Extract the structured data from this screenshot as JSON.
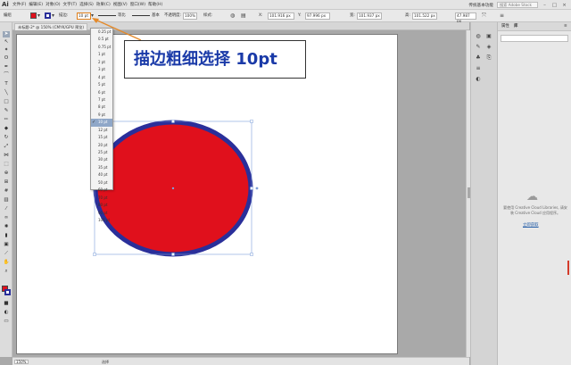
{
  "app": {
    "logo": "Ai",
    "menu": [
      "文件(F)",
      "编辑(E)",
      "对象(O)",
      "文字(T)",
      "选择(S)",
      "效果(C)",
      "视图(V)",
      "窗口(W)",
      "帮助(H)"
    ],
    "workspace": "传统基本功能",
    "search_placeholder": "搜索 Adobe Stock",
    "window_buttons": [
      "–",
      "□",
      "×"
    ]
  },
  "control_bar": {
    "selection_label": "编组",
    "stroke_label": "描边:",
    "stroke_weight_value": "10 pt",
    "stroke_profile_label": "等比",
    "brush_label": "基本",
    "opacity_label": "不透明度:",
    "opacity_value": "100%",
    "style_label": "样式:",
    "x_label": "X:",
    "x_value": "101.916 px",
    "y_label": "Y:",
    "y_value": "97.996 px",
    "w_label": "宽:",
    "w_value": "101.937 px",
    "h_label": "高:",
    "h_value": "101.522 px",
    "angle_value": "47.987 px"
  },
  "document": {
    "tab_title": "未标题-2* @ 150% (CMYK/GPU 预览)",
    "zoom_value": "150%",
    "tool_status": "选择"
  },
  "stroke_dropdown": {
    "items": [
      "0.25 pt",
      "0.5 pt",
      "0.75 pt",
      "1 pt",
      "2 pt",
      "3 pt",
      "4 pt",
      "5 pt",
      "6 pt",
      "7 pt",
      "8 pt",
      "9 pt",
      "10 pt",
      "12 pt",
      "15 pt",
      "20 pt",
      "25 pt",
      "30 pt",
      "35 pt",
      "40 pt",
      "50 pt",
      "60 pt",
      "70 pt",
      "80 pt",
      "90 pt",
      "100 pt"
    ],
    "selected_index": 12
  },
  "callout": {
    "text": "描边粗细选择 10pt"
  },
  "ellipse": {
    "fill_color": "#e3091b",
    "stroke_color": "#2b3598",
    "stroke_weight_pt": 10
  },
  "panel": {
    "tabs": [
      "属性",
      "库"
    ],
    "message": "要使用 Creative Cloud Libraries, 请安装 Creative Cloud 应用程序。",
    "link": "立即获取"
  },
  "colors": {
    "fill": "#e0101c",
    "stroke": "#2a2f9a",
    "callout_text": "#1a3aa8",
    "arrow": "#e58a2a",
    "selection": "#7f9fd9"
  }
}
